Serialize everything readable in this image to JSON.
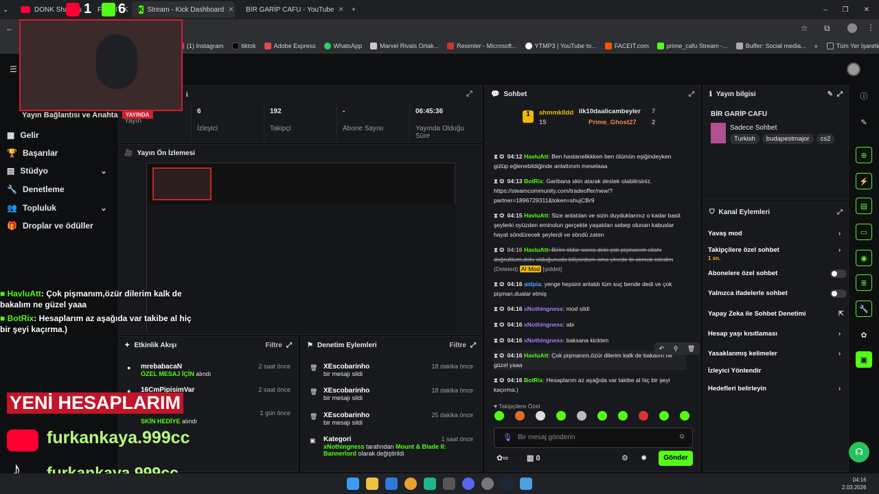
{
  "browser": {
    "tabs": [
      {
        "label": "DONK Shatters",
        "icon": "youtube"
      },
      {
        "label": "FACEIT K",
        "icon": "faceit"
      },
      {
        "label": "Stream - Kick Dashboard",
        "icon": "kick"
      },
      {
        "label": "BİR GARİP CAFU - YouTube",
        "icon": "youtube"
      }
    ],
    "bookmarks": [
      "(1) Instagram",
      "tiktok",
      "Adobe Express",
      "WhatsApp",
      "Marvel Rivals Ortak...",
      "Resimler - Microsoft...",
      "YTMP3 | YouTube to...",
      "FACEIT.com",
      "prime_cafu Stream -...",
      "Buffer: Social media..."
    ],
    "all_bookmarks": "Tüm Yer İşaretleri"
  },
  "webcam": {
    "overlay_numbers": [
      "1",
      "6"
    ]
  },
  "sidebar": {
    "partial_title": "Yayın Bağlantısı ve Anahtarı",
    "live_badge": "YAYINDA",
    "items": [
      {
        "label": "Gelir",
        "icon": "revenue-icon"
      },
      {
        "label": "Başarılar",
        "icon": "trophy-icon"
      },
      {
        "label": "Stüdyo",
        "icon": "studio-icon",
        "chevron": true
      },
      {
        "label": "Denetleme",
        "icon": "wrench-icon"
      },
      {
        "label": "Topluluk",
        "icon": "people-icon",
        "chevron": true
      },
      {
        "label": "Droplar ve ödüller",
        "icon": "gift-icon"
      }
    ]
  },
  "stats": {
    "section_letter": "i",
    "items": [
      {
        "value": "",
        "label": "Yayın"
      },
      {
        "value": "6",
        "label": "İzleyici"
      },
      {
        "value": "192",
        "label": "Takipçi"
      },
      {
        "value": "-",
        "label": "Abone Sayısı"
      },
      {
        "value": "06:45:36",
        "label": "Yayında Olduğu Süre"
      }
    ]
  },
  "preview": {
    "title": "Yayın Ön İzlemesi"
  },
  "overlay": {
    "chat": [
      {
        "user": "HavluAtt",
        "text": ": Çok pişmanım,özür dilerim kalk de bakalım ne güzel yaaa"
      },
      {
        "user": "BotRix",
        "text": ": Hesaplarım az aşağıda var takibe al hiç bir şeyi kaçırma.)"
      }
    ],
    "new_accounts": "YENİ HESAPLARIM",
    "youtube": "furkankaya.999cc",
    "tiktok": "furkankaya.999cc"
  },
  "activity": {
    "title": "Etkinlik Akışı",
    "filter": "Filtre",
    "items": [
      {
        "name": "mrebabacaN",
        "desc_em": "ÖZEL MESAJ İÇİN",
        "desc": " alındı",
        "time": "2 saat önce"
      },
      {
        "name": "16CmPipisimVar",
        "desc_em": "",
        "desc": "",
        "time": "2 saat önce"
      },
      {
        "name": "",
        "desc_em": "SKİN HEDİYE",
        "desc": " alındı",
        "time": "1 gün önce"
      }
    ]
  },
  "moderation": {
    "title": "Denetim Eylemleri",
    "filter": "Filtre",
    "items": [
      {
        "name": "XEscobarinho",
        "desc": "bir mesajı sildi",
        "time": "18 dakika önce"
      },
      {
        "name": "XEscobarinho",
        "desc": "bir mesajı sildi",
        "time": "18 dakika önce"
      },
      {
        "name": "XEscobarinho",
        "desc": "bir mesajı sildi",
        "time": "25 dakika önce"
      },
      {
        "name": "Kategori",
        "desc_user": "xNothingness",
        "desc_mid": " tarafından ",
        "desc_game": "Mount & Blade II: Bannerlord",
        "desc_end": " olarak değiştirildi",
        "time": "1 saat önce"
      }
    ]
  },
  "chat": {
    "title": "Sohbet",
    "top": [
      {
        "name": "ahmmklldd",
        "count": "15"
      },
      {
        "name": "ilk10daalicambeyler",
        "count": "7"
      },
      {
        "name": "Prime_Ghost27",
        "count": "2"
      }
    ],
    "messages": [
      {
        "time": "04:12",
        "user": "HavluAtt",
        "cls": "u1",
        "text": ": Ben hastanelikkken ben ölümün eşiğindeyken gülüp eğlenebildiğinde anlattınım meselaaa"
      },
      {
        "time": "04:13",
        "user": "BotRix",
        "cls": "u1",
        "text": ": Garibana skin atarak destek olabilirsiniz. https://steamcommunity.com/tradeoffer/new/?partner=1896729311&token=shujCBr9"
      },
      {
        "time": "04:15",
        "user": "HavluAtt",
        "cls": "u1",
        "text": ": Size anlatılan ve sizin duyduklarınız o kadar basit şeylerki oyüzden eminolun gerçekte yaşatılan sebep olunan kabuslar hayat söndürecek şeylerdi ve söndü zaten"
      },
      {
        "time": "04:16",
        "user": "HavluAtt",
        "cls": "u1",
        "text": ": Birini öldür sonra deki çok pişmanım silahı doğrulttum,dolu olduğunuda biliyordum ama yinede bi akmak istedim",
        "deleted": "(Deleted)",
        "mod": "AI Mod",
        "tag": "[şiddet]"
      },
      {
        "time": "04:16",
        "user": "aidpia",
        "cls": "u3",
        "text": ": yenge hepsini anlatdı tüm suç bende dedi ve çok pişman,dualar etmiş"
      },
      {
        "time": "04:16",
        "user": "xNothingness",
        "cls": "u2",
        "text": ": mod sildi"
      },
      {
        "time": "04:16",
        "user": "xNothingness",
        "cls": "u2",
        "text": ": abi"
      },
      {
        "time": "04:16",
        "user": "xNothingness",
        "cls": "u2",
        "text": ": baksana kickten"
      },
      {
        "time": "04:16",
        "user": "HavluAtt",
        "cls": "u1",
        "text": ": Çok pişmanım,özür dilerim kalk de bakalım ne güzel yaaa"
      },
      {
        "time": "04:16",
        "user": "BotRix",
        "cls": "u1",
        "text": ": Hesaplarım az aşağıda var takibe al hiç bir şeyi kaçırma.)"
      }
    ],
    "followers_only": "Takipçilere Özel",
    "placeholder": "Bir mesaj gönderin",
    "points": "0",
    "send": "Gönder"
  },
  "info": {
    "title": "Yayın bilgisi",
    "channel": "BİR GARİP CAFU",
    "stream_title": "Sadece Sohbet",
    "tags": [
      "Turkish",
      "budapestmajor",
      "cs2"
    ]
  },
  "channel_actions": {
    "title": "Kanal Eylemleri",
    "items": [
      {
        "label": "Yavaş mod",
        "type": "arrow"
      },
      {
        "label": "Takipçilere özel sohbet",
        "sub": "1 sn.",
        "type": "arrow"
      },
      {
        "label": "Abonelere özel sohbet",
        "type": "toggle"
      },
      {
        "label": "Yalnızca ifadelerle sohbet",
        "type": "toggle"
      },
      {
        "label": "Yapay Zeka ile Sohbet Denetimi",
        "type": "ext"
      },
      {
        "label": "Hesap yaşı kısıtlaması",
        "type": "arrow"
      },
      {
        "label": "Yasaklanmış kelimeler",
        "type": "arrow"
      },
      {
        "label": "İzleyici Yönlendir",
        "type": "none"
      },
      {
        "label": "Hedefleri belirleyin",
        "type": "arrow"
      }
    ]
  },
  "clock": {
    "time": "04:16",
    "date": "2.03.2026"
  },
  "colors": {
    "kick_green": "#53fc18",
    "panel": "#18191c",
    "bg": "#0e0f11"
  }
}
